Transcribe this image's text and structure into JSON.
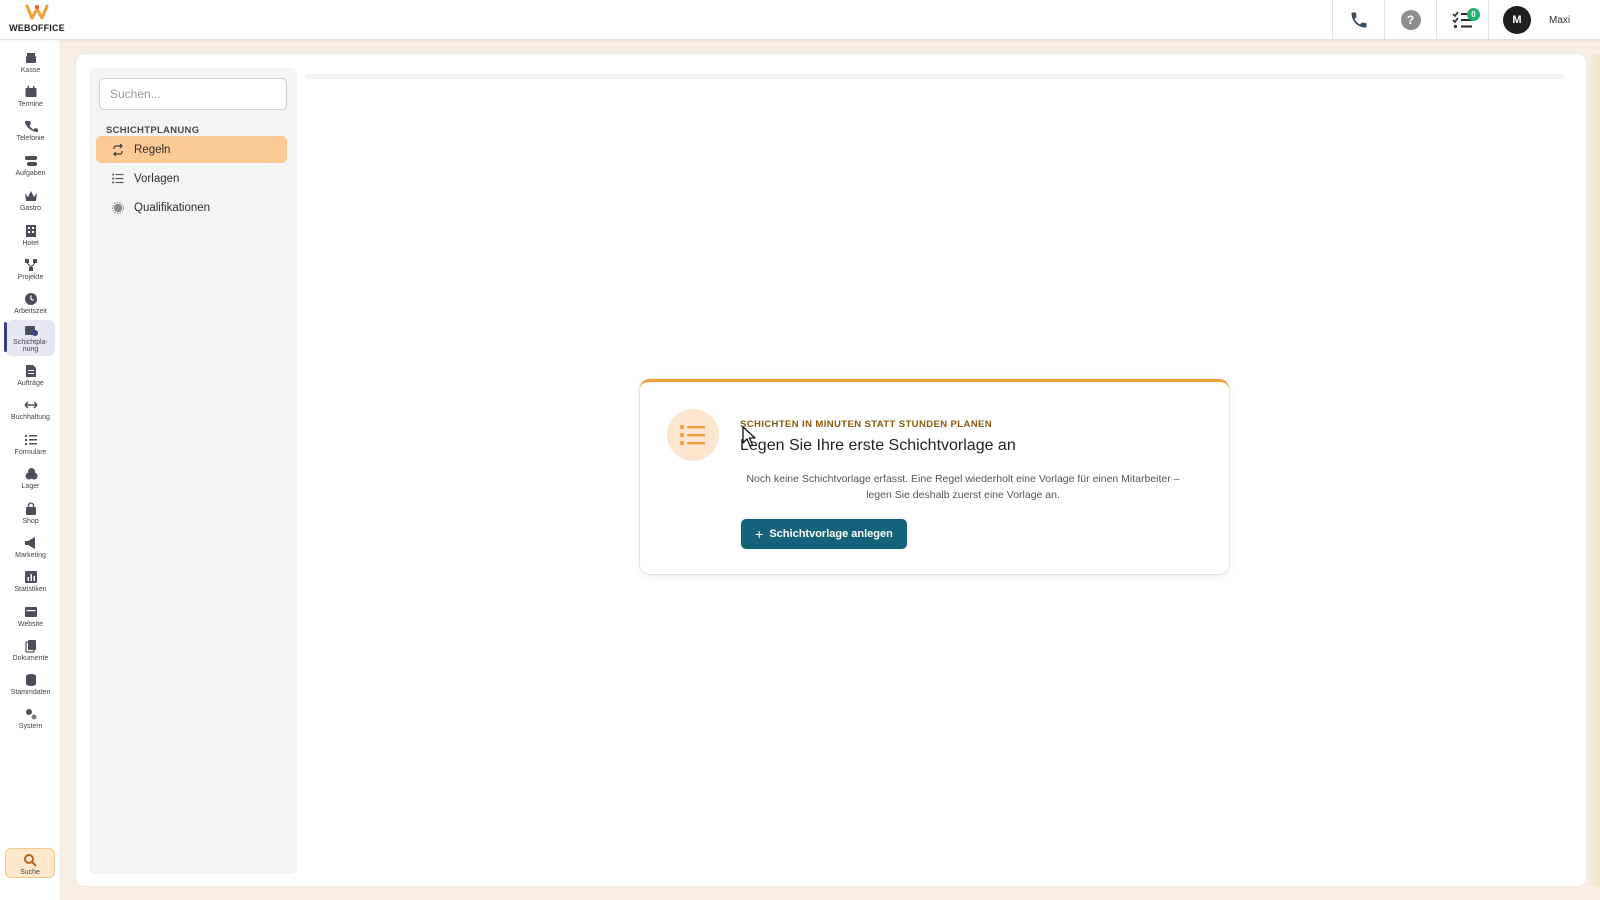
{
  "app": {
    "logo_text": "WEBOFFICE",
    "brand_color": "#f0a037"
  },
  "topbar": {
    "phone_icon": "phone-icon",
    "help_icon": "help-icon",
    "help_glyph": "?",
    "tasks_icon": "tasks-icon",
    "tasks_badge": "0",
    "user": {
      "initial": "M",
      "name": "Maxi"
    }
  },
  "leftnav": {
    "items": [
      {
        "label": "Kasse",
        "icon": "cash-register-icon"
      },
      {
        "label": "Termine",
        "icon": "calendar-icon"
      },
      {
        "label": "Telefonie",
        "icon": "phone-icon"
      },
      {
        "label": "Aufgaben",
        "icon": "tasks-icon"
      },
      {
        "label": "Gastro",
        "icon": "crown-icon"
      },
      {
        "label": "Hotel",
        "icon": "building-icon"
      },
      {
        "label": "Projekte",
        "icon": "project-icon"
      },
      {
        "label": "Arbeitszeit",
        "icon": "clock-icon"
      },
      {
        "label": "Schichtpla-\nnung",
        "icon": "shift-calendar-icon",
        "active": true
      },
      {
        "label": "Aufträge",
        "icon": "document-icon"
      },
      {
        "label": "Buchhaltung",
        "icon": "arrows-icon"
      },
      {
        "label": "Formulare",
        "icon": "list-check-icon"
      },
      {
        "label": "Lager",
        "icon": "boxes-icon"
      },
      {
        "label": "Shop",
        "icon": "bag-icon"
      },
      {
        "label": "Marketing",
        "icon": "megaphone-icon"
      },
      {
        "label": "Statistiken",
        "icon": "chart-icon"
      },
      {
        "label": "Website",
        "icon": "window-icon"
      },
      {
        "label": "Dokumente",
        "icon": "files-icon"
      },
      {
        "label": "Stammdaten",
        "icon": "database-icon"
      },
      {
        "label": "System",
        "icon": "gears-icon"
      }
    ],
    "search_label": "Suche",
    "active_color": "#3b3f8f"
  },
  "subnav": {
    "search_placeholder": "Suchen...",
    "section_title": "SCHICHTPLANUNG",
    "items": [
      {
        "label": "Regeln",
        "icon": "repeat-icon",
        "active": true
      },
      {
        "label": "Vorlagen",
        "icon": "list-icon"
      },
      {
        "label": "Qualifikationen",
        "icon": "badge-icon"
      }
    ],
    "active_color": "#fdc994"
  },
  "empty_state": {
    "eyebrow": "SCHICHTEN IN MINUTEN STATT STUNDEN PLANEN",
    "title": "Legen Sie Ihre erste Schichtvorlage an",
    "description": "Noch keine Schichtvorlage erfasst. Eine Regel wiederholt eine Vorlage für einen Mitarbeiter – legen Sie deshalb zuerst eine Vorlage an.",
    "button_label": "Schichtvorlage anlegen",
    "button_color": "#15637a",
    "icon": "list-icon"
  }
}
